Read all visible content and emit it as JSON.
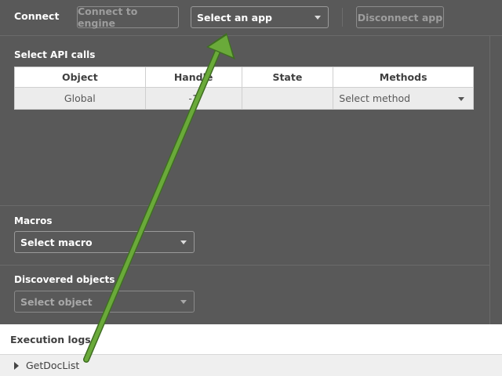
{
  "connect": {
    "label": "Connect",
    "connect_button": "Connect to engine",
    "app_select": "Select an app",
    "disconnect_button": "Disconnect app"
  },
  "api": {
    "title": "Select API calls",
    "columns": [
      "Object",
      "Handle",
      "State",
      "Methods"
    ],
    "rows": [
      {
        "object": "Global",
        "handle": "-1",
        "state": "",
        "method": "Select method"
      }
    ]
  },
  "macros": {
    "title": "Macros",
    "select": "Select macro"
  },
  "objects": {
    "title": "Discovered objects",
    "select": "Select object"
  },
  "logs": {
    "title": "Execution logs",
    "entries": [
      "GetDocList"
    ]
  },
  "colors": {
    "background": "#595959",
    "annotation_arrow": "#6aaa3a"
  }
}
